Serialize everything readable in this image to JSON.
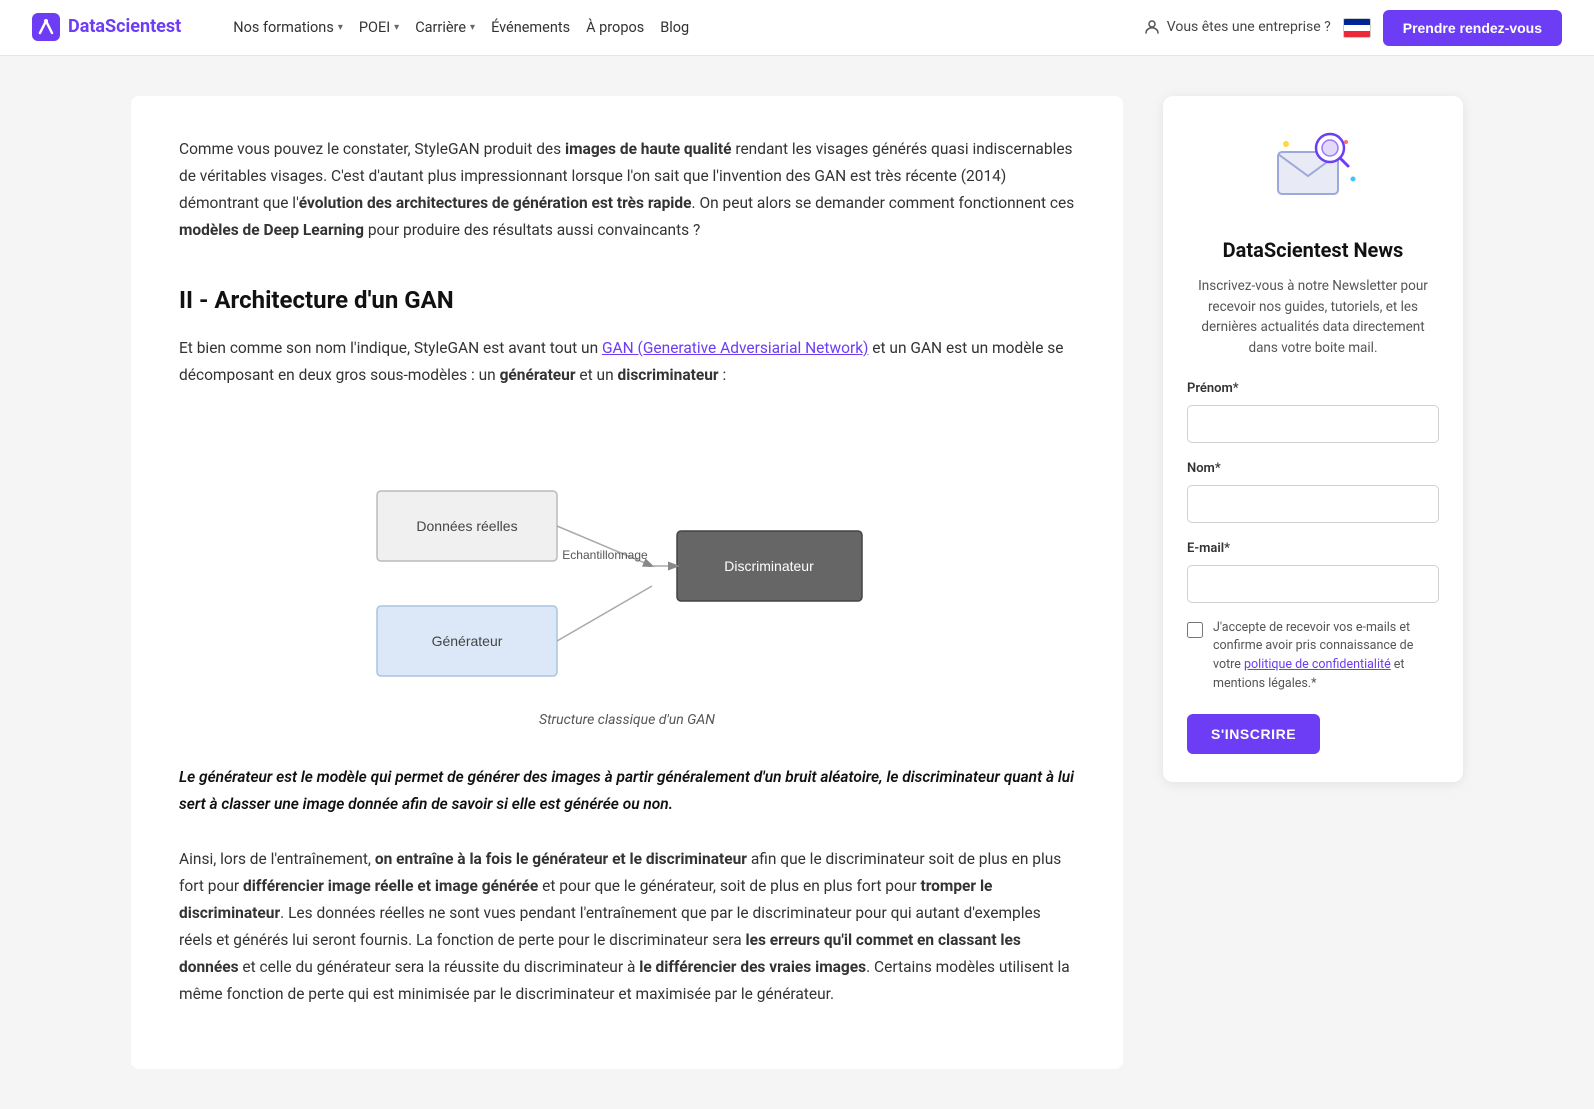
{
  "nav": {
    "logo_text": "DataScientest",
    "links": [
      {
        "label": "Nos formations",
        "has_dropdown": true
      },
      {
        "label": "POEI",
        "has_dropdown": true
      },
      {
        "label": "Carrière",
        "has_dropdown": true
      },
      {
        "label": "Événements",
        "has_dropdown": false
      },
      {
        "label": "À propos",
        "has_dropdown": false
      },
      {
        "label": "Blog",
        "has_dropdown": false
      }
    ],
    "enterprise_label": "Vous êtes une entreprise ?",
    "cta_label": "Prendre rendez-vous"
  },
  "article": {
    "intro_para": "Comme vous pouvez le constater, StyleGAN produit des images de haute qualité rendant les visages générés quasi indiscernables de véritables visages. C'est d'autant plus impressionnant lorsque l'on sait que l'invention des GAN est très récente (2014) démontrant que l'évolution des architectures de génération est très rapide. On peut alors se demander comment fonctionnent ces modèles de Deep Learning pour produire des résultats aussi convaincants ?",
    "section_title": "II - Architecture d'un GAN",
    "section_para": "Et bien comme son nom l'indique, StyleGAN est avant tout un GAN (Generative Adversiarial Network) et un GAN est un modèle se décomposant en deux gros sous-modèles : un générateur et un discriminateur :",
    "gan_link_text": "GAN (Generative Adversiarial Network)",
    "diagram_caption": "Structure classique d'un GAN",
    "quote": "Le générateur est le modèle qui permet de générer des images à partir généralement d'un bruit aléatoire, le discriminateur quant à lui sert à classer une image donnée afin de savoir si elle est générée ou non.",
    "main_para": "Ainsi, lors de l'entraînement, on entraîne à la fois le générateur et le discriminateur afin que le discriminateur soit de plus en plus fort pour différencier image réelle et image générée et pour que le générateur, soit de plus en plus fort pour tromper le discriminateur. Les données réelles ne sont vues pendant l'entraînement que par le discriminateur pour qui autant d'exemples réels et générés lui seront fournis. La fonction de perte pour le discriminateur sera les erreurs qu'il commet en classant les données et celle du générateur sera la réussite du discriminateur à le différencier des vraies images. Certains modèles utilisent la même fonction de perte qui est minimisée par le discriminateur et maximisée par le générateur.",
    "diagram_nodes": {
      "donnees_reelles": "Données réelles",
      "echantillonnage": "Echantillonnage",
      "discriminateur": "Discriminateur",
      "generateur": "Générateur"
    }
  },
  "sidebar": {
    "title": "DataScientest News",
    "description": "Inscrivez-vous à notre Newsletter pour recevoir nos guides, tutoriels, et les dernières actualités data directement dans votre boite mail.",
    "form": {
      "prenom_label": "Prénom*",
      "prenom_placeholder": "",
      "nom_label": "Nom*",
      "nom_placeholder": "",
      "email_label": "E-mail*",
      "email_placeholder": "",
      "checkbox_label": "J'accepte de recevoir vos e-mails et confirme avoir pris connaissance de votre politique de confidentialité et mentions légales.*",
      "submit_label": "S'INSCRIRE"
    }
  }
}
